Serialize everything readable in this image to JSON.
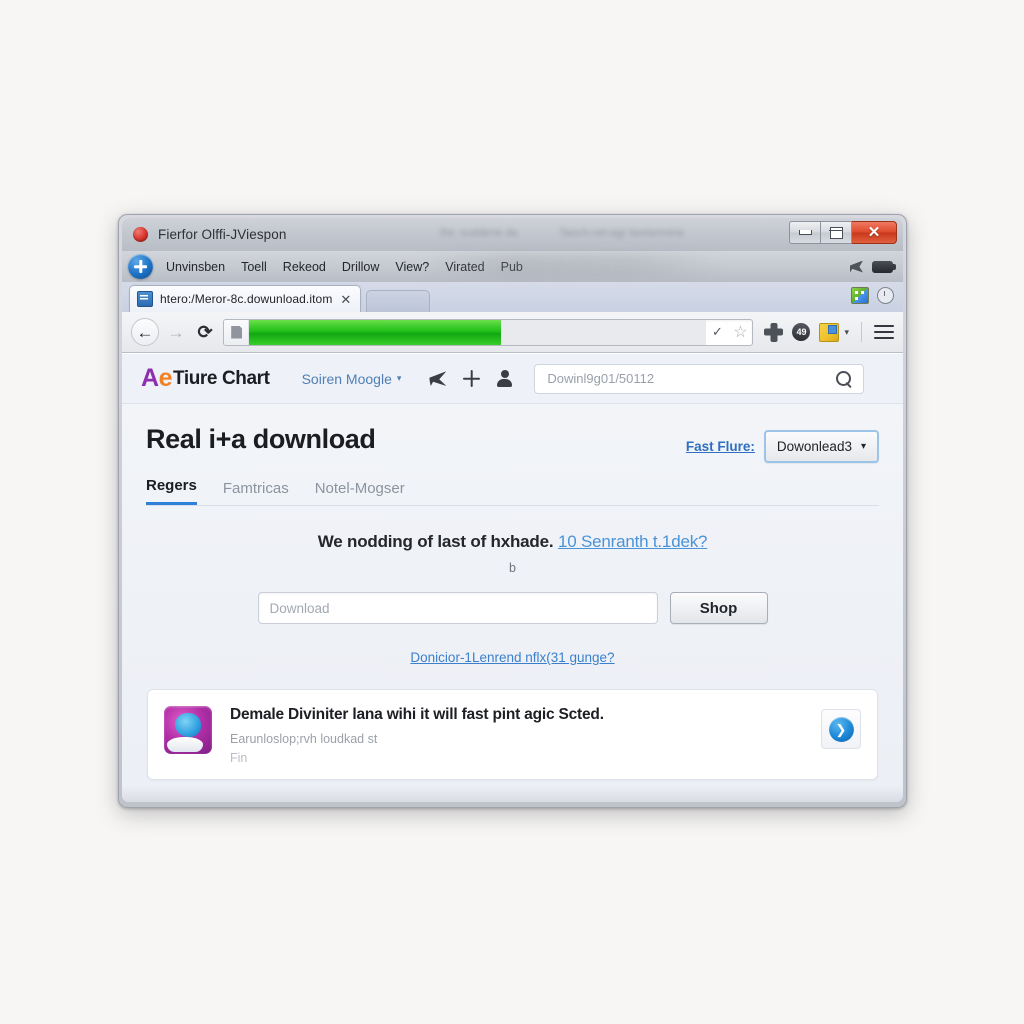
{
  "window": {
    "title": "Fierfor Olffi-JViespon",
    "title_ghost_1": "Re: suddene da",
    "title_ghost_2": "Taoch-nel-agr bestermine",
    "minimize_label": "Minimize",
    "maximize_label": "Maximize",
    "close_label": "Close"
  },
  "menubar": {
    "items": [
      {
        "label": "Unvinsben"
      },
      {
        "label": "Toell"
      },
      {
        "label": "Rekeod"
      },
      {
        "label": "Drillow"
      },
      {
        "label": "View?"
      },
      {
        "label": "Virated"
      },
      {
        "label": "Pub"
      }
    ]
  },
  "tabstrip": {
    "tab_title": "htero:/Meror-8c.dowunload.itom",
    "tab_close": "✕"
  },
  "navbar": {
    "back": "←",
    "forward": "→",
    "reload": "⟳",
    "check": "✓",
    "star": "☆",
    "badge_count": "49",
    "caret": "▾",
    "progress_percent": 55
  },
  "site": {
    "logo_a": "A",
    "logo_e": "e",
    "logo_text": "Tiure Chart",
    "account": "Soiren Moogle",
    "account_caret": "▾"
  },
  "search": {
    "value": "",
    "placeholder": "Dowinl9g01/50112"
  },
  "main": {
    "page_title": "Real i+a download",
    "fast_link": "Fast Flure:",
    "dropdown_value": "Dowonlead3",
    "dropdown_caret": "▾",
    "tabs": [
      {
        "label": "Regers",
        "active": true
      },
      {
        "label": "Famtricas",
        "active": false
      },
      {
        "label": "Notel-Mogser",
        "active": false
      }
    ],
    "hero_text": "We nodding of last of hxhade.",
    "hero_link": "10 Senranth t.1dek?",
    "hero_sub": "b",
    "download_placeholder": "Download",
    "download_value": "",
    "shop_button": "Shop",
    "mid_link": "Donicior-1Lenrend nflx(31 gunge?"
  },
  "card": {
    "title": "Demale Diviniter lana wihi it will fast pint agic Scted.",
    "subtitle": "Earunloslop;rvh loudkad st",
    "subtitle2": "Fin",
    "go_arrow": "❯"
  },
  "colors": {
    "accent_blue": "#2f80d8",
    "link_blue": "#3b80cc",
    "progress_green": "#1fbf18",
    "close_red": "#de4a2c",
    "logo_purple": "#8e2fb0",
    "logo_orange": "#f08223"
  }
}
